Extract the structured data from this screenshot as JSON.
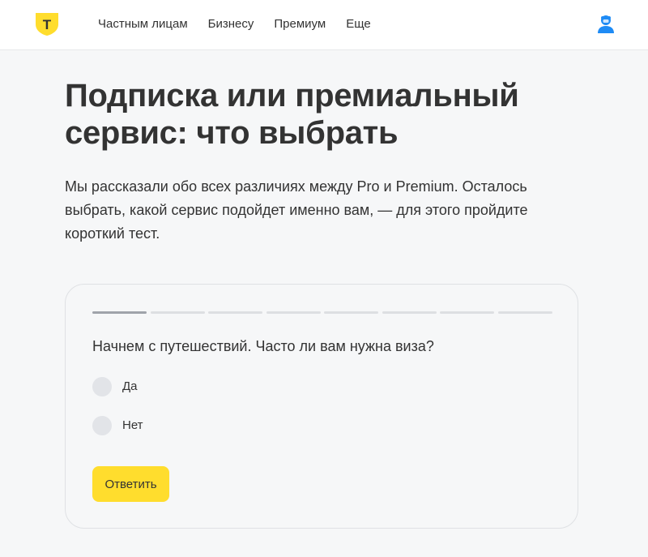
{
  "header": {
    "logo_icon": "bank-shield-logo-icon",
    "logo_letter": "Т",
    "nav": [
      {
        "label": "Частным лицам"
      },
      {
        "label": "Бизнесу"
      },
      {
        "label": "Премиум"
      },
      {
        "label": "Еще"
      }
    ],
    "user_icon": "user-avatar-icon"
  },
  "article": {
    "title": "Подписка или премиальный сервис: что выбрать",
    "intro": "Мы рассказали обо всех различиях между Pro и Premium. Осталось выбрать, какой сервис подойдет именно вам, — для этого пройдите короткий тест."
  },
  "quiz": {
    "progress": {
      "current": 1,
      "total": 8
    },
    "question": "Начнем с путешествий. Часто ли вам нужна виза?",
    "options": [
      {
        "label": "Да"
      },
      {
        "label": "Нет"
      }
    ],
    "submit_label": "Ответить"
  },
  "colors": {
    "accent": "#ffdd2d",
    "page_background": "#f6f7f8",
    "text": "#333333",
    "user_icon": "#1e8bf5"
  }
}
